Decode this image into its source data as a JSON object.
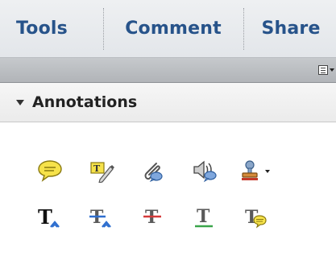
{
  "tabs": [
    {
      "label": "Tools"
    },
    {
      "label": "Comment"
    },
    {
      "label": "Share"
    }
  ],
  "section": {
    "title": "Annotations"
  },
  "icons": {
    "panel_menu": "panel-options-menu-icon",
    "sticky_note": "sticky-note-icon",
    "highlight_text": "highlight-text-icon",
    "attach_file": "attach-file-icon",
    "record_audio": "record-audio-icon",
    "add_stamp": "add-stamp-icon",
    "insert_text": "insert-text-at-cursor-icon",
    "replace_text": "replace-text-icon",
    "strikethrough": "strikethrough-text-icon",
    "underline": "underline-text-icon",
    "text_comment": "add-note-to-text-icon"
  },
  "colors": {
    "tab_text": "#27538a",
    "sticky_yellow": "#f6e24a",
    "caret_blue": "#2f6fcf",
    "strike_red": "#d43a3a",
    "underline_green": "#3aa54a"
  }
}
